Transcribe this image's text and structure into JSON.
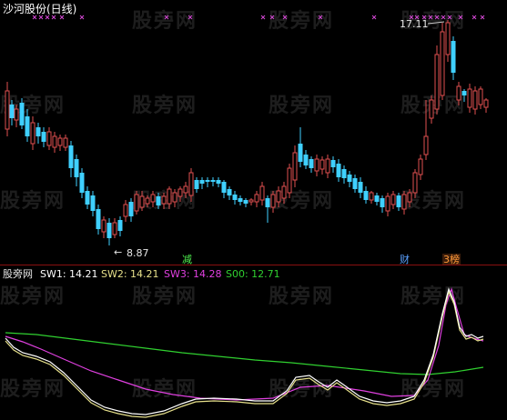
{
  "title": "沙河股份(日线)",
  "watermark_text": "股旁网",
  "price_labels": {
    "high": "17.11",
    "low": "8.87",
    "low_arrow": "←"
  },
  "signals": {
    "jian": "减",
    "cai": "财",
    "bang": "3榜"
  },
  "indicator": {
    "name": "股旁网",
    "sw1": "SW1: 14.21",
    "sw2": "SW2: 14.21",
    "sw3": "SW3: 14.28",
    "s00": "S00: 12.71"
  },
  "colors": {
    "background": "#000000",
    "up": "#e05050",
    "down": "#3fd0ff",
    "mark": "#d448d4",
    "sw1": "#ffffff",
    "sw2": "#e6e08a",
    "sw3": "#e040e0",
    "s00": "#30d030"
  }
}
